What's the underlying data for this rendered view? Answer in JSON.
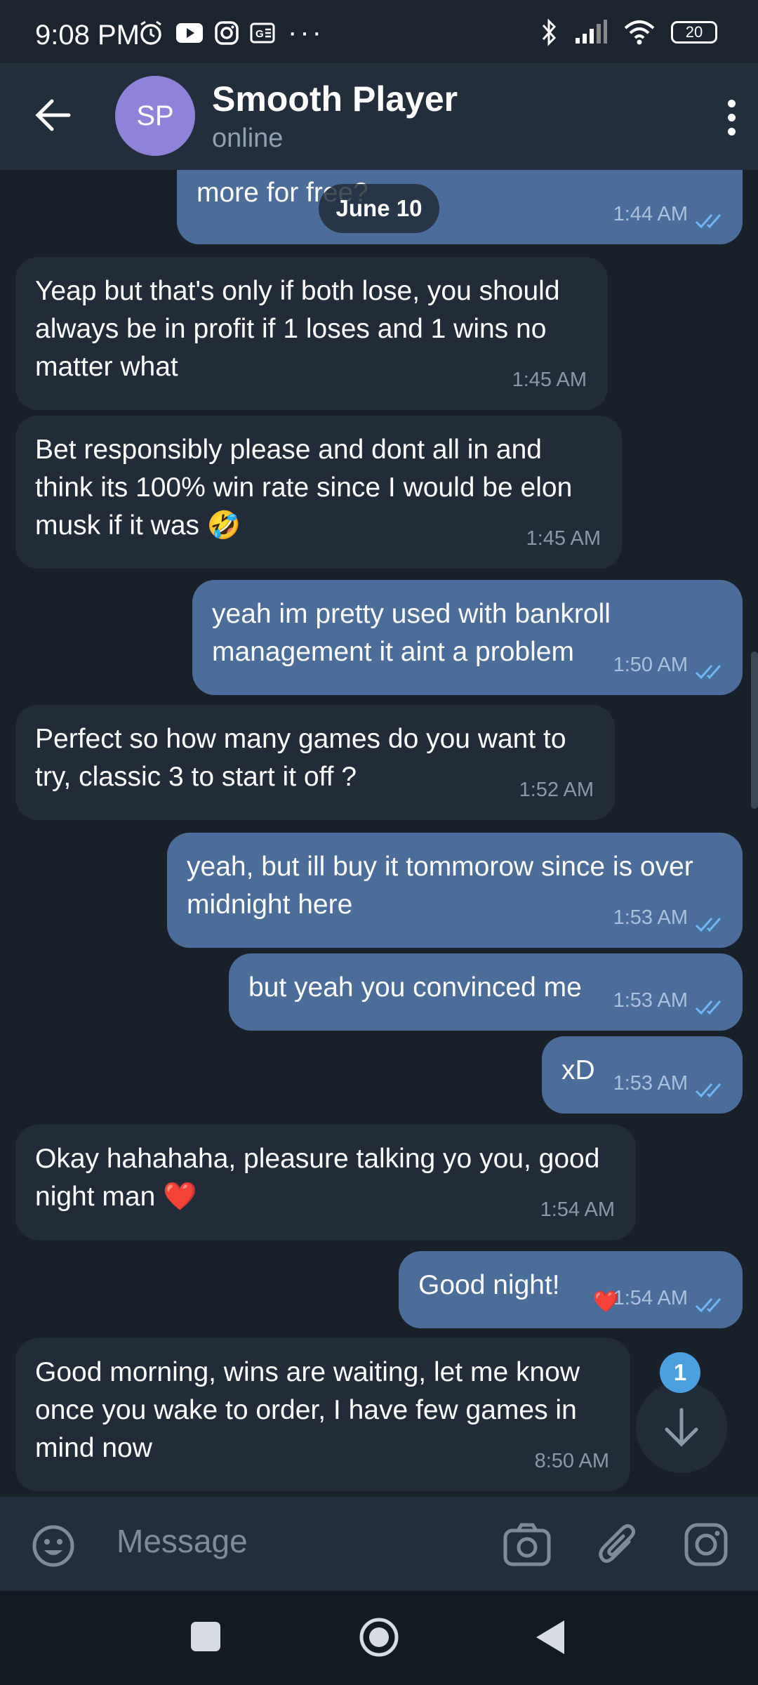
{
  "status_bar": {
    "time": "9:08 PM",
    "left_icons": [
      "alarm-icon",
      "youtube-icon",
      "instagram-icon",
      "ge-icon"
    ],
    "overflow": "···",
    "right_icons": [
      "bluetooth-icon",
      "signal-icon",
      "wifi-icon"
    ],
    "battery": "20"
  },
  "header": {
    "avatar_initials": "SP",
    "name": "Smooth Player",
    "status": "online"
  },
  "date_pill": "June 10",
  "messages": [
    {
      "dir": "out",
      "text": "for a bet who loses you said you give one more for free?",
      "time": "1:44 AM",
      "read": true
    },
    {
      "dir": "in",
      "text": "Yeap but that's only if both lose, you should always be in profit if 1 loses and 1 wins no matter what",
      "time": "1:45 AM"
    },
    {
      "dir": "in",
      "text": "Bet responsibly please and dont all in and think its 100% win rate since I would be elon musk if it was 🤣",
      "time": "1:45 AM"
    },
    {
      "dir": "out",
      "text": "yeah im pretty used with bankroll management it aint a problem",
      "time": "1:50 AM",
      "read": true
    },
    {
      "dir": "in",
      "text": "Perfect so how many games do you want to try, classic 3 to start it off ?",
      "time": "1:52 AM"
    },
    {
      "dir": "out",
      "text": "yeah, but ill buy it tommorow since is over midnight here",
      "time": "1:53 AM",
      "read": true
    },
    {
      "dir": "out",
      "text": "but yeah you convinced me",
      "time": "1:53 AM",
      "read": true
    },
    {
      "dir": "out",
      "text": "xD",
      "time": "1:53 AM",
      "read": true
    },
    {
      "dir": "in",
      "text": "Okay hahahaha, pleasure talking yo you, good night man ❤️",
      "time": "1:54 AM"
    },
    {
      "dir": "out",
      "text": "Good night!",
      "time": "1:54 AM",
      "read": true,
      "reaction": "❤️"
    },
    {
      "dir": "in",
      "text": "Good morning, wins are waiting, let me know once you wake to order, I have few games in mind now",
      "time": "8:50 AM"
    }
  ],
  "scroll_down": {
    "unread_count": "1"
  },
  "composer": {
    "placeholder": "Message",
    "icons": [
      "emoji-icon",
      "camera-icon",
      "attach-icon",
      "instagram-icon"
    ]
  },
  "nav_bar": {
    "icons": [
      "recents-icon",
      "home-icon",
      "back-icon"
    ]
  },
  "colors": {
    "background": "#18202a",
    "header": "#232e3c",
    "incoming_bubble": "#222c38",
    "outgoing_bubble": "#4a6d99",
    "read_check": "#6fb6f2",
    "unread_badge": "#4ba0e0"
  }
}
